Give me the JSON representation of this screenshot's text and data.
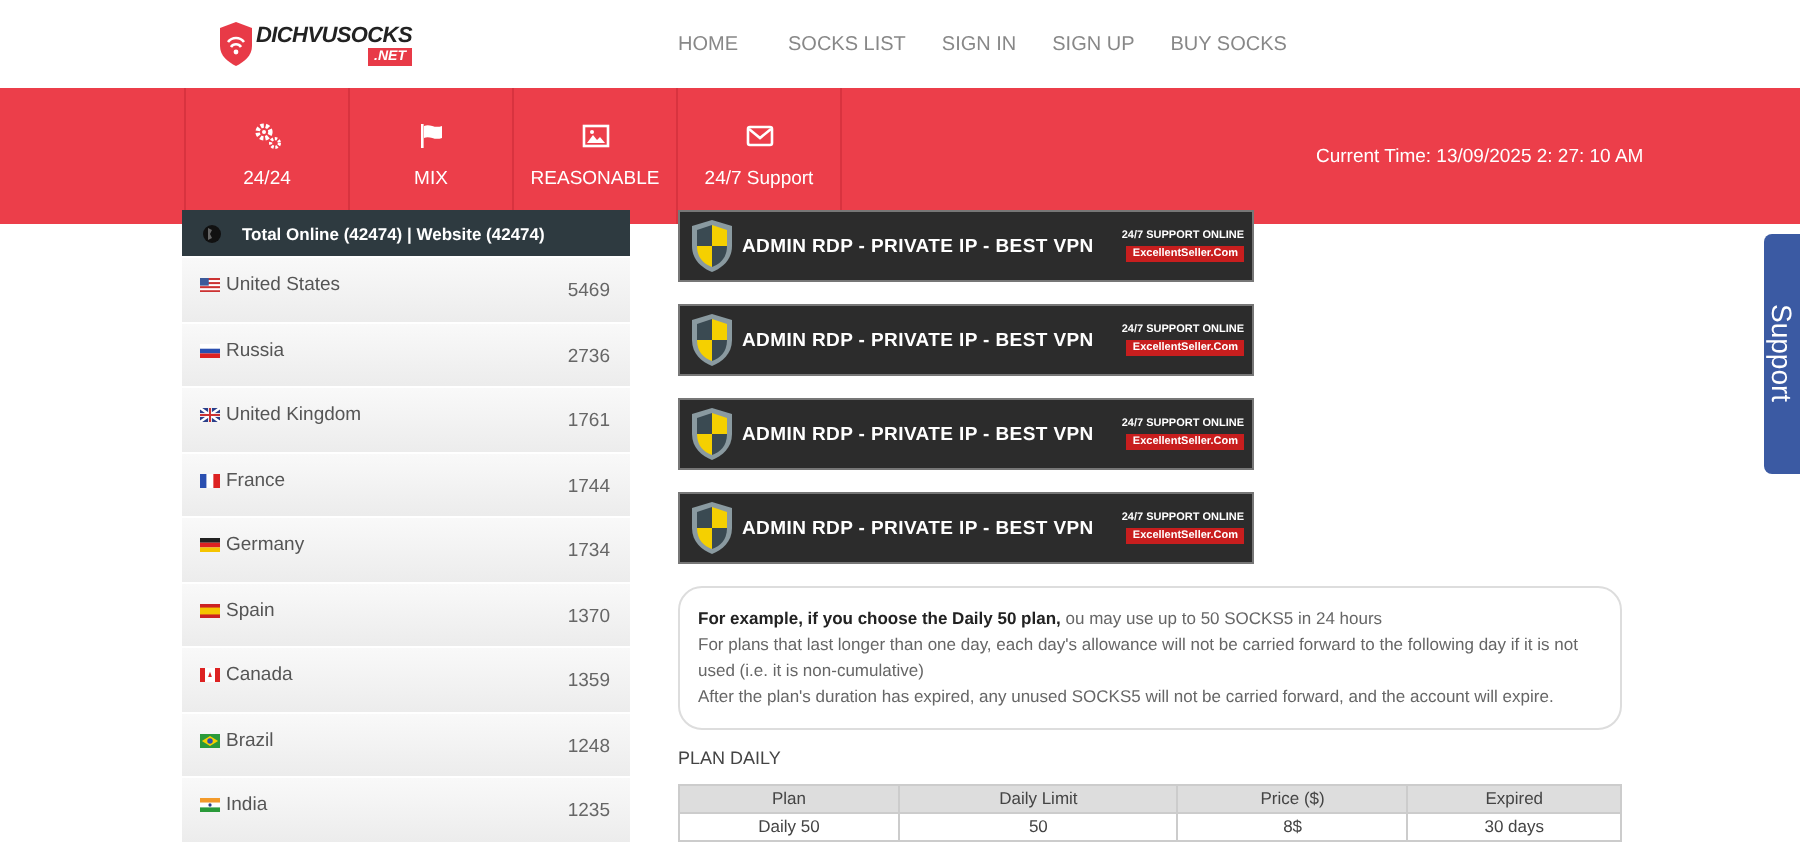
{
  "logo": {
    "name": "DICHVUSOCKS",
    "suffix": ".NET"
  },
  "nav": [
    "HOME",
    "SOCKS LIST",
    "SIGN IN",
    "SIGN UP",
    "BUY SOCKS"
  ],
  "features": [
    {
      "kind": "gears",
      "label": "24/24"
    },
    {
      "kind": "flag",
      "label": "MIX"
    },
    {
      "kind": "image",
      "label": "REASONABLE"
    },
    {
      "kind": "mail",
      "label": "24/7 Support"
    }
  ],
  "current_time": "Current Time: 13/09/2025 2: 27: 10 AM",
  "online_panel": {
    "title": "Total Online (42474) | Website (42474)",
    "countries": [
      {
        "name": "United States",
        "count": "5469"
      },
      {
        "name": "Russia",
        "count": "2736"
      },
      {
        "name": "United Kingdom",
        "count": "1761"
      },
      {
        "name": "France",
        "count": "1744"
      },
      {
        "name": "Germany",
        "count": "1734"
      },
      {
        "name": "Spain",
        "count": "1370"
      },
      {
        "name": "Canada",
        "count": "1359"
      },
      {
        "name": "Brazil",
        "count": "1248"
      },
      {
        "name": "India",
        "count": "1235"
      }
    ]
  },
  "banners": [
    {
      "headline": "ADMIN RDP - PRIVATE IP - BEST VPN",
      "support": "24/7 SUPPORT ONLINE",
      "site": "ExcellentSeller.Com"
    },
    {
      "headline": "ADMIN RDP - PRIVATE IP - BEST VPN",
      "support": "24/7 SUPPORT ONLINE",
      "site": "ExcellentSeller.Com"
    },
    {
      "headline": "ADMIN RDP - PRIVATE IP - BEST VPN",
      "support": "24/7 SUPPORT ONLINE",
      "site": "ExcellentSeller.Com"
    },
    {
      "headline": "ADMIN RDP - PRIVATE IP - BEST VPN",
      "support": "24/7 SUPPORT ONLINE",
      "site": "ExcellentSeller.Com"
    }
  ],
  "note": [
    "**For example, if you choose the Daily 50 plan,** ou may use up to 50 SOCKS5 in 24 hours",
    "For plans that last longer than one day, each day's allowance will not be carried forward to the following day if it is not used (i.e. it is non-cumulative)",
    "After the plan's duration has expired, any unused SOCKS5 will not be carried forward, and the account will expire."
  ],
  "plan_title": "PLAN DAILY",
  "table": {
    "columns": [
      "Plan",
      "Daily Limit",
      "Price ($)",
      "Expired"
    ],
    "rows": [
      [
        "Daily 50",
        "50",
        "8$",
        "30 days"
      ]
    ]
  },
  "support_tab": "Support"
}
